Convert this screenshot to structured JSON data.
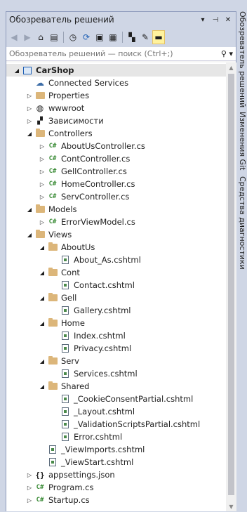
{
  "panel": {
    "title": "Обозреватель решений"
  },
  "search": {
    "placeholder": "Обозреватель решений — поиск (Ctrl+;)"
  },
  "side_tabs": [
    "Обозреватель решений",
    "Изменения Git",
    "Средства диагностики"
  ],
  "tree": [
    {
      "label": "CarShop",
      "level": 0,
      "arrow": "open",
      "icon": "solution-icon",
      "bold": true,
      "selected": true
    },
    {
      "label": "Connected Services",
      "level": 1,
      "arrow": "none",
      "icon": "connected-services-icon"
    },
    {
      "label": "Properties",
      "level": 1,
      "arrow": "closed",
      "icon": "properties-icon"
    },
    {
      "label": "wwwroot",
      "level": 1,
      "arrow": "closed",
      "icon": "globe-icon"
    },
    {
      "label": "Зависимости",
      "level": 1,
      "arrow": "closed",
      "icon": "dependencies-icon"
    },
    {
      "label": "Controllers",
      "level": 1,
      "arrow": "open",
      "icon": "folder-icon"
    },
    {
      "label": "AboutUsController.cs",
      "level": 2,
      "arrow": "closed",
      "icon": "cs-file-icon"
    },
    {
      "label": "ContController.cs",
      "level": 2,
      "arrow": "closed",
      "icon": "cs-file-icon"
    },
    {
      "label": "GellController.cs",
      "level": 2,
      "arrow": "closed",
      "icon": "cs-file-icon"
    },
    {
      "label": "HomeController.cs",
      "level": 2,
      "arrow": "closed",
      "icon": "cs-file-icon"
    },
    {
      "label": "ServController.cs",
      "level": 2,
      "arrow": "closed",
      "icon": "cs-file-icon"
    },
    {
      "label": "Models",
      "level": 1,
      "arrow": "open",
      "icon": "folder-icon"
    },
    {
      "label": "ErrorViewModel.cs",
      "level": 2,
      "arrow": "closed",
      "icon": "cs-file-icon"
    },
    {
      "label": "Views",
      "level": 1,
      "arrow": "open",
      "icon": "folder-icon"
    },
    {
      "label": "AboutUs",
      "level": 2,
      "arrow": "open",
      "icon": "folder-icon"
    },
    {
      "label": "About_As.cshtml",
      "level": 3,
      "arrow": "none",
      "icon": "cshtml-file-icon"
    },
    {
      "label": "Cont",
      "level": 2,
      "arrow": "open",
      "icon": "folder-icon"
    },
    {
      "label": "Contact.cshtml",
      "level": 3,
      "arrow": "none",
      "icon": "cshtml-file-icon"
    },
    {
      "label": "Gell",
      "level": 2,
      "arrow": "open",
      "icon": "folder-icon"
    },
    {
      "label": "Gallery.cshtml",
      "level": 3,
      "arrow": "none",
      "icon": "cshtml-file-icon"
    },
    {
      "label": "Home",
      "level": 2,
      "arrow": "open",
      "icon": "folder-icon"
    },
    {
      "label": "Index.cshtml",
      "level": 3,
      "arrow": "none",
      "icon": "cshtml-file-icon"
    },
    {
      "label": "Privacy.cshtml",
      "level": 3,
      "arrow": "none",
      "icon": "cshtml-file-icon"
    },
    {
      "label": "Serv",
      "level": 2,
      "arrow": "open",
      "icon": "folder-icon"
    },
    {
      "label": "Services.cshtml",
      "level": 3,
      "arrow": "none",
      "icon": "cshtml-file-icon"
    },
    {
      "label": "Shared",
      "level": 2,
      "arrow": "open",
      "icon": "folder-icon"
    },
    {
      "label": "_CookieConsentPartial.cshtml",
      "level": 3,
      "arrow": "none",
      "icon": "cshtml-file-icon"
    },
    {
      "label": "_Layout.cshtml",
      "level": 3,
      "arrow": "none",
      "icon": "cshtml-file-icon"
    },
    {
      "label": "_ValidationScriptsPartial.cshtml",
      "level": 3,
      "arrow": "none",
      "icon": "cshtml-file-icon"
    },
    {
      "label": "Error.cshtml",
      "level": 3,
      "arrow": "none",
      "icon": "cshtml-file-icon"
    },
    {
      "label": "_ViewImports.cshtml",
      "level": 2,
      "arrow": "none",
      "icon": "cshtml-file-icon"
    },
    {
      "label": "_ViewStart.cshtml",
      "level": 2,
      "arrow": "none",
      "icon": "cshtml-file-icon"
    },
    {
      "label": "appsettings.json",
      "level": 1,
      "arrow": "closed",
      "icon": "json-file-icon"
    },
    {
      "label": "Program.cs",
      "level": 1,
      "arrow": "closed",
      "icon": "cs-file-icon"
    },
    {
      "label": "Startup.cs",
      "level": 1,
      "arrow": "closed",
      "icon": "cs-file-icon"
    }
  ]
}
